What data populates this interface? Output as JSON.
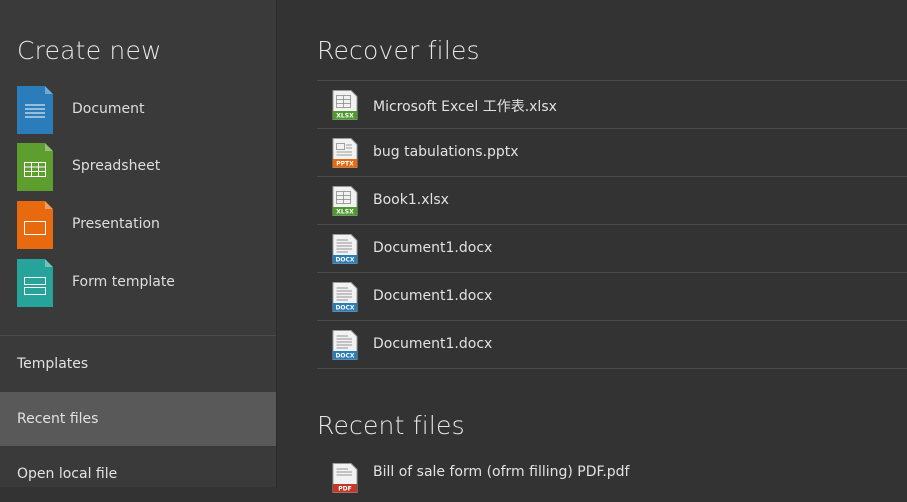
{
  "sidebar": {
    "create_title": "Create new",
    "create_items": [
      {
        "label": "Document",
        "color": "#2a7cba",
        "icon": "document-icon"
      },
      {
        "label": "Spreadsheet",
        "color": "#5e9e2f",
        "icon": "spreadsheet-icon"
      },
      {
        "label": "Presentation",
        "color": "#e8690e",
        "icon": "presentation-icon"
      },
      {
        "label": "Form template",
        "color": "#26a39a",
        "icon": "form-template-icon"
      }
    ],
    "nav": [
      {
        "label": "Templates",
        "active": false
      },
      {
        "label": "Recent files",
        "active": true
      },
      {
        "label": "Open local file",
        "active": false
      }
    ]
  },
  "recover": {
    "title": "Recover files",
    "files": [
      {
        "name": "Microsoft Excel 工作表.xlsx",
        "type": "XLSX"
      },
      {
        "name": "bug tabulations.pptx",
        "type": "PPTX"
      },
      {
        "name": "Book1.xlsx",
        "type": "XLSX"
      },
      {
        "name": "Document1.docx",
        "type": "DOCX"
      },
      {
        "name": "Document1.docx",
        "type": "DOCX"
      },
      {
        "name": "Document1.docx",
        "type": "DOCX"
      }
    ]
  },
  "recent": {
    "title": "Recent files",
    "files": [
      {
        "name": "Bill of sale form (ofrm filling) PDF.pdf",
        "type": "PDF"
      }
    ]
  },
  "colors": {
    "background": "#333333",
    "sidebar": "#3a3a3a",
    "active_nav": "#595959",
    "xlsx_badge": "#4e9a2e",
    "pptx_badge": "#e8690e",
    "docx_badge": "#2a7cba",
    "pdf_badge": "#c0392b"
  }
}
